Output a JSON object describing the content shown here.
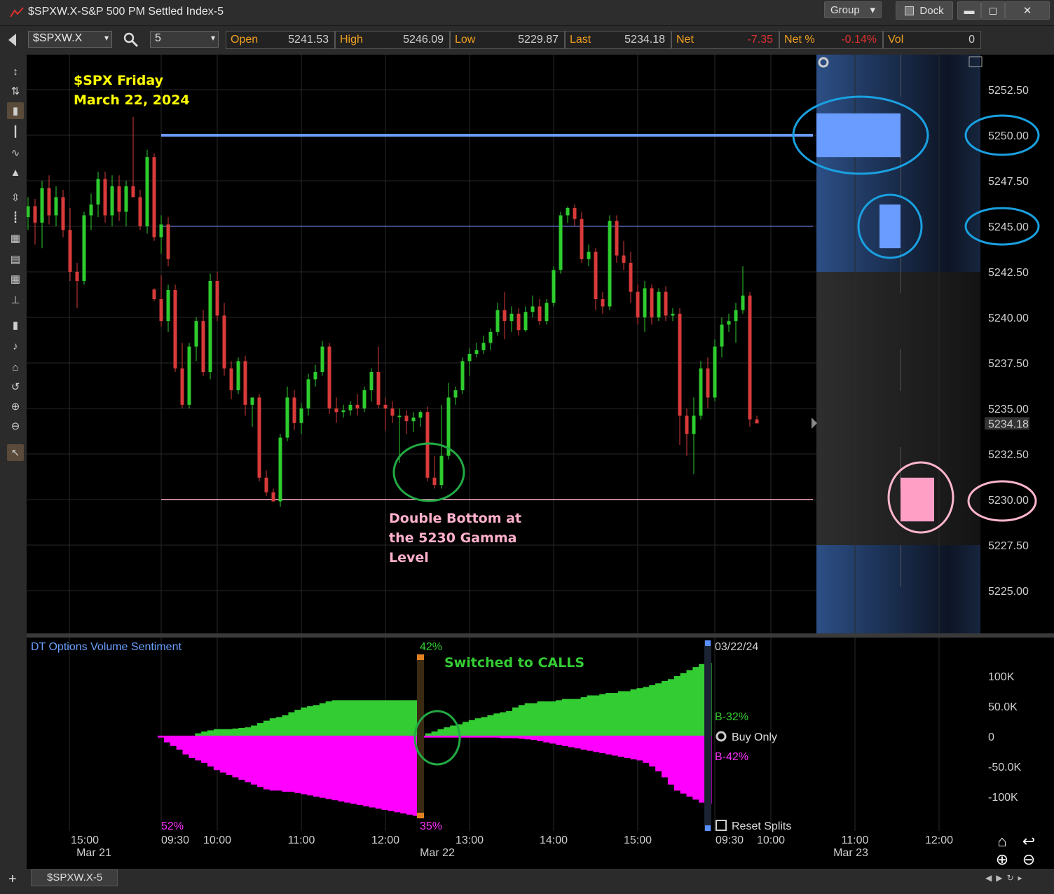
{
  "window": {
    "title": "$SPXW.X-S&P 500 PM Settled Index-5",
    "group_label": "Group",
    "dock_label": "Dock",
    "minimize": "▬",
    "maximize": "◻",
    "close": "✕"
  },
  "toolbar": {
    "symbol": "$SPXW.X",
    "interval": "5",
    "quote": [
      {
        "label": "Open",
        "value": "5241.53",
        "negative": false
      },
      {
        "label": "High",
        "value": "5246.09",
        "negative": false
      },
      {
        "label": "Low",
        "value": "5229.87",
        "negative": false
      },
      {
        "label": "Last",
        "value": "5234.18",
        "negative": false
      },
      {
        "label": "Net",
        "value": "-7.35",
        "negative": true
      },
      {
        "label": "Net %",
        "value": "-0.14%",
        "negative": true
      },
      {
        "label": "Vol",
        "value": "0",
        "negative": false
      }
    ]
  },
  "left_tools": [
    "cursor-move-icon",
    "crosshair-icon",
    "candlestick-icon",
    "bar-style-icon",
    "line-style-icon",
    "area-style-icon",
    "spacing-icon",
    "indicator-icon",
    "grid-icon",
    "table-icon",
    "table-small-icon",
    "study-icon",
    "draw-tool-icon",
    "note-icon",
    "home-icon",
    "undo-icon",
    "zoom-in-icon",
    "zoom-out-icon",
    "pointer-icon"
  ],
  "annotations": {
    "title_line1": "$SPX Friday",
    "title_line2": "March 22, 2024",
    "double_bottom_line1": "Double Bottom at",
    "double_bottom_line2": "the 5230 Gamma",
    "double_bottom_line3": "Level",
    "switched": "Switched to CALLS"
  },
  "colors": {
    "up": "#2ecc2e",
    "down": "#d93a3a",
    "level_5250": "#6a9cff",
    "level_5245": "#7a90ff",
    "level_5230": "#ffb0cc",
    "ellipse_blue": "#1aa0e0",
    "ellipse_pink": "#ffb6cc",
    "ellipse_green": "#22aa44",
    "calls": "#33cc33",
    "puts": "#ff00ff",
    "annotation_yellow": "#ffff00",
    "annotation_pink": "#ffb0cc",
    "annotation_green": "#33cc33"
  },
  "chart_data": {
    "type": "candlestick",
    "symbol": "$SPXW.X",
    "interval_minutes": 5,
    "ylim": [
      5223.0,
      5254.0
    ],
    "y_ticks": [
      "5252.50",
      "5250.00",
      "5247.50",
      "5245.00",
      "5242.50",
      "5240.00",
      "5237.50",
      "5235.00",
      "5232.50",
      "5230.00",
      "5227.50",
      "5225.00"
    ],
    "last_price_label": "5234.18",
    "x_tick_labels": [
      "15:00",
      "09:30",
      "10:00",
      "11:00",
      "12:00",
      "13:00",
      "14:00",
      "15:00",
      "09:30",
      "10:00",
      "11:00",
      "12:00"
    ],
    "date_labels": [
      "Mar 21",
      "Mar 22",
      "Mar 23"
    ],
    "levels": [
      {
        "price": 5250,
        "label": "5250.00"
      },
      {
        "price": 5245,
        "label": "5245.00"
      },
      {
        "price": 5230,
        "label": "5230.00"
      }
    ],
    "candles_mar21": [
      [
        5245.5,
        5246.6,
        5244.8,
        5246.1
      ],
      [
        5246.1,
        5246.5,
        5244.0,
        5245.2
      ],
      [
        5245.2,
        5247.5,
        5243.8,
        5247.1
      ],
      [
        5247.1,
        5247.8,
        5245.1,
        5245.6
      ],
      [
        5245.6,
        5247.2,
        5245.0,
        5246.6
      ],
      [
        5246.6,
        5247.0,
        5244.4,
        5244.8
      ],
      [
        5244.8,
        5246.0,
        5242.0,
        5242.5
      ],
      [
        5242.5,
        5243.0,
        5240.5,
        5242.0
      ],
      [
        5242.0,
        5245.8,
        5241.8,
        5245.6
      ],
      [
        5245.6,
        5246.8,
        5244.8,
        5246.2
      ],
      [
        5246.2,
        5248.0,
        5245.5,
        5247.6
      ],
      [
        5247.6,
        5248.0,
        5245.2,
        5245.6
      ],
      [
        5245.6,
        5247.8,
        5245.0,
        5247.2
      ],
      [
        5247.2,
        5247.8,
        5245.3,
        5245.8
      ],
      [
        5245.8,
        5247.5,
        5245.0,
        5247.2
      ],
      [
        5247.2,
        5251.0,
        5246.6,
        5246.6
      ],
      [
        5246.6,
        5247.0,
        5244.8,
        5245.0
      ],
      [
        5245.0,
        5249.2,
        5244.6,
        5248.8
      ],
      [
        5248.8,
        5249.0,
        5244.2,
        5244.4
      ],
      [
        5244.4,
        5245.6,
        5243.5,
        5245.1
      ],
      [
        5245.1,
        5245.5,
        5242.8,
        5243.2
      ]
    ],
    "candles_mar22": [
      [
        5241.53,
        5241.6,
        5240.9,
        5241.0
      ],
      [
        5241.0,
        5242.3,
        5239.5,
        5239.8
      ],
      [
        5239.8,
        5241.8,
        5239.2,
        5241.5
      ],
      [
        5241.5,
        5241.8,
        5237.0,
        5237.2
      ],
      [
        5237.2,
        5238.6,
        5235.0,
        5235.2
      ],
      [
        5235.2,
        5238.6,
        5235.0,
        5238.4
      ],
      [
        5238.4,
        5240.0,
        5237.6,
        5239.8
      ],
      [
        5239.8,
        5240.4,
        5236.8,
        5237.0
      ],
      [
        5237.0,
        5242.4,
        5236.6,
        5242.0
      ],
      [
        5242.0,
        5242.5,
        5239.8,
        5240.1
      ],
      [
        5240.1,
        5240.8,
        5236.8,
        5237.2
      ],
      [
        5237.2,
        5237.6,
        5235.5,
        5236.0
      ],
      [
        5236.0,
        5237.8,
        5235.8,
        5237.6
      ],
      [
        5237.6,
        5237.9,
        5234.6,
        5235.2
      ],
      [
        5235.2,
        5235.5,
        5234.0,
        5235.6
      ],
      [
        5235.6,
        5235.8,
        5231.0,
        5231.2
      ],
      [
        5231.2,
        5231.6,
        5230.2,
        5230.4
      ],
      [
        5230.4,
        5230.6,
        5229.87,
        5229.9
      ],
      [
        5229.9,
        5233.6,
        5229.6,
        5233.4
      ],
      [
        5233.4,
        5236.2,
        5233.2,
        5235.6
      ],
      [
        5235.6,
        5236.0,
        5233.8,
        5234.2
      ],
      [
        5234.2,
        5235.3,
        5233.6,
        5235.0
      ],
      [
        5235.0,
        5236.9,
        5234.6,
        5236.6
      ],
      [
        5236.6,
        5237.4,
        5236.2,
        5237.0
      ],
      [
        5237.0,
        5238.7,
        5236.8,
        5238.4
      ],
      [
        5238.4,
        5238.6,
        5234.7,
        5235.0
      ],
      [
        5235.0,
        5235.6,
        5234.2,
        5234.8
      ],
      [
        5234.8,
        5235.2,
        5234.5,
        5234.9
      ],
      [
        5234.9,
        5235.4,
        5234.6,
        5235.2
      ],
      [
        5235.2,
        5235.8,
        5234.6,
        5235.0
      ],
      [
        5235.0,
        5236.2,
        5234.8,
        5236.0
      ],
      [
        5236.0,
        5237.2,
        5235.4,
        5237.0
      ],
      [
        5237.0,
        5238.4,
        5235.0,
        5235.2
      ],
      [
        5235.2,
        5235.6,
        5233.8,
        5235.0
      ],
      [
        5235.0,
        5235.4,
        5234.2,
        5234.6
      ],
      [
        5234.6,
        5235.0,
        5232.0,
        5234.6
      ],
      [
        5234.6,
        5234.9,
        5233.6,
        5234.3
      ],
      [
        5234.3,
        5234.8,
        5233.7,
        5234.5
      ],
      [
        5234.5,
        5234.9,
        5234.0,
        5234.8
      ],
      [
        5234.8,
        5235.1,
        5231.0,
        5231.2
      ],
      [
        5231.2,
        5232.4,
        5230.6,
        5230.8
      ],
      [
        5230.8,
        5235.2,
        5230.6,
        5232.4
      ],
      [
        5232.4,
        5236.4,
        5232.2,
        5235.6
      ],
      [
        5235.6,
        5236.2,
        5235.2,
        5236.0
      ],
      [
        5236.0,
        5237.8,
        5235.8,
        5237.6
      ],
      [
        5237.6,
        5238.3,
        5236.8,
        5238.0
      ],
      [
        5238.0,
        5238.6,
        5237.8,
        5238.2
      ],
      [
        5238.2,
        5239.0,
        5238.0,
        5238.6
      ],
      [
        5238.6,
        5239.4,
        5238.2,
        5239.2
      ],
      [
        5239.2,
        5240.8,
        5239.0,
        5240.4
      ],
      [
        5240.4,
        5241.4,
        5238.8,
        5239.8
      ],
      [
        5239.8,
        5240.6,
        5239.2,
        5240.2
      ],
      [
        5240.2,
        5240.5,
        5239.0,
        5239.3
      ],
      [
        5239.3,
        5240.6,
        5239.2,
        5240.3
      ],
      [
        5240.3,
        5241.2,
        5240.0,
        5240.6
      ],
      [
        5240.6,
        5241.0,
        5239.6,
        5239.8
      ],
      [
        5239.8,
        5241.0,
        5239.6,
        5240.8
      ],
      [
        5240.8,
        5242.8,
        5240.6,
        5242.6
      ],
      [
        5242.6,
        5245.8,
        5242.4,
        5245.6
      ],
      [
        5245.6,
        5246.09,
        5245.2,
        5246.0
      ],
      [
        5246.0,
        5246.2,
        5245.0,
        5245.4
      ],
      [
        5245.4,
        5245.8,
        5243.0,
        5243.2
      ],
      [
        5243.2,
        5244.0,
        5242.8,
        5243.6
      ],
      [
        5243.6,
        5243.8,
        5240.4,
        5241.0
      ],
      [
        5241.0,
        5241.4,
        5240.2,
        5240.6
      ],
      [
        5240.6,
        5245.6,
        5240.4,
        5245.3
      ],
      [
        5245.3,
        5245.6,
        5243.0,
        5243.4
      ],
      [
        5243.4,
        5244.2,
        5242.6,
        5243.0
      ],
      [
        5243.0,
        5243.6,
        5240.8,
        5241.4
      ],
      [
        5241.4,
        5241.8,
        5239.6,
        5240.0
      ],
      [
        5240.0,
        5242.0,
        5239.2,
        5241.6
      ],
      [
        5241.6,
        5241.8,
        5239.6,
        5240.0
      ],
      [
        5240.0,
        5241.6,
        5239.8,
        5241.4
      ],
      [
        5241.4,
        5241.7,
        5239.8,
        5240.1
      ],
      [
        5240.1,
        5240.5,
        5239.8,
        5240.2
      ],
      [
        5240.2,
        5240.5,
        5233.0,
        5234.6
      ],
      [
        5234.6,
        5235.0,
        5232.4,
        5233.6
      ],
      [
        5233.6,
        5235.6,
        5231.4,
        5234.6
      ],
      [
        5234.6,
        5237.6,
        5234.4,
        5237.2
      ],
      [
        5237.2,
        5237.8,
        5235.0,
        5235.6
      ],
      [
        5235.6,
        5238.8,
        5235.4,
        5238.4
      ],
      [
        5238.4,
        5240.0,
        5237.8,
        5239.6
      ],
      [
        5239.6,
        5240.2,
        5239.2,
        5239.8
      ],
      [
        5239.8,
        5240.8,
        5238.6,
        5240.4
      ],
      [
        5240.4,
        5242.8,
        5240.2,
        5241.2
      ],
      [
        5241.2,
        5241.4,
        5234.0,
        5234.4
      ],
      [
        5234.4,
        5234.6,
        5234.2,
        5234.18
      ]
    ]
  },
  "sentiment": {
    "title": "DT Options Volume Sentiment",
    "ylim": [
      -135000,
      130000
    ],
    "y_tick_labels": [
      "100K",
      "50.0K",
      "0",
      "-50.0K",
      "-100K"
    ],
    "date_label": "03/22/24",
    "b_calls": "B-32%",
    "b_puts": "B-42%",
    "buy_only": "Buy Only",
    "reset_splits": "Reset Splits",
    "pct_top": "42%",
    "pct_bottom": "35%",
    "pct_left": "52%",
    "calls": [
      0,
      0,
      0,
      0,
      0,
      0,
      5000,
      8000,
      10000,
      12000,
      12000,
      12000,
      13000,
      14000,
      15000,
      18000,
      22000,
      26000,
      30000,
      32000,
      35000,
      40000,
      44000,
      48000,
      50000,
      52000,
      55000,
      58000,
      60000,
      60000,
      60000,
      60000,
      60000,
      60000,
      60000,
      60000,
      60000,
      60000,
      60000,
      60000,
      60000,
      60000,
      0,
      5000,
      8000,
      12000,
      15000,
      18000,
      20000,
      24000,
      27000,
      30000,
      32000,
      35000,
      38000,
      40000,
      42000,
      48000,
      52000,
      55000,
      55000,
      58000,
      58000,
      58000,
      60000,
      62000,
      62000,
      62000,
      65000,
      68000,
      68000,
      70000,
      72000,
      72000,
      75000,
      75000,
      78000,
      80000,
      82000,
      85000,
      88000,
      92000,
      95000,
      100000,
      105000,
      110000,
      115000,
      120000,
      122000
    ],
    "puts": [
      -2000,
      -10000,
      -16000,
      -22000,
      -30000,
      -36000,
      -40000,
      -44000,
      -50000,
      -56000,
      -60000,
      -64000,
      -68000,
      -72000,
      -76000,
      -80000,
      -84000,
      -88000,
      -90000,
      -90000,
      -92000,
      -92000,
      -94000,
      -96000,
      -98000,
      -100000,
      -102000,
      -104000,
      -106000,
      -108000,
      -110000,
      -112000,
      -114000,
      -116000,
      -118000,
      -120000,
      -122000,
      -124000,
      -126000,
      -128000,
      -130000,
      -132000,
      -2000,
      -2000,
      -2000,
      -2000,
      -2000,
      -2000,
      -2000,
      -2000,
      -2000,
      -2000,
      -2000,
      -2000,
      -2000,
      -3000,
      -3000,
      -3000,
      -4000,
      -5000,
      -6000,
      -8000,
      -10000,
      -12000,
      -14000,
      -16000,
      -18000,
      -20000,
      -22000,
      -24000,
      -26000,
      -28000,
      -30000,
      -32000,
      -34000,
      -36000,
      -38000,
      -40000,
      -44000,
      -50000,
      -58000,
      -68000,
      -80000,
      -90000,
      -95000,
      -100000,
      -105000,
      -110000,
      -112000
    ]
  },
  "bottom": {
    "tab": "$SPXW.X-5",
    "add": "+"
  }
}
